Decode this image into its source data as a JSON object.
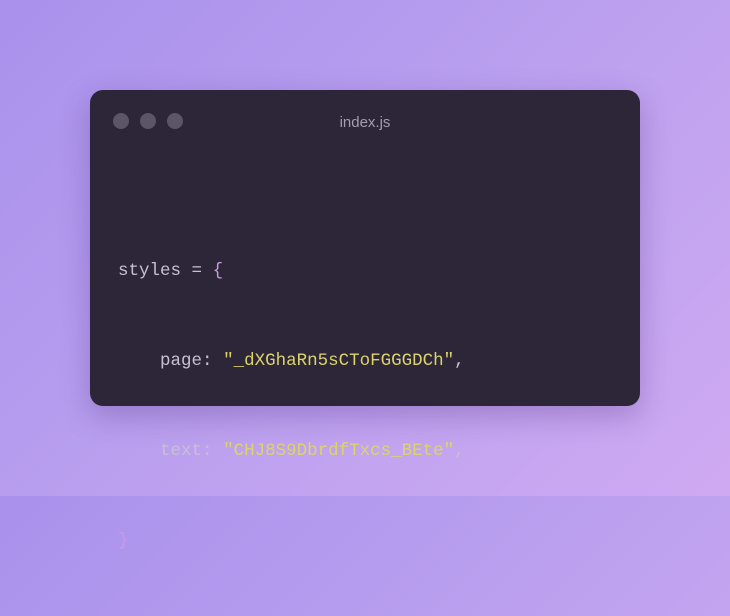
{
  "window": {
    "title": "index.js",
    "traffic_lights": [
      {
        "name": "close",
        "color": "#5b5566"
      },
      {
        "name": "minimize",
        "color": "#5b5566"
      },
      {
        "name": "maximize",
        "color": "#5b5566"
      }
    ]
  },
  "code": {
    "var_name": "styles",
    "assign_op": "=",
    "open_brace": "{",
    "close_brace": "}",
    "entries": [
      {
        "key": "page",
        "value": "\"_dXGhaRn5sCToFGGGDCh\""
      },
      {
        "key": "text",
        "value": "\"CHJ8S9DbrdfTxcs_BEte\""
      }
    ]
  },
  "colors": {
    "background_start": "#a991ec",
    "background_end": "#cfaaf2",
    "editor_bg": "#2c2638",
    "string": "#dcd36b",
    "brace": "#c99be6",
    "text": "#c6c0d3"
  }
}
